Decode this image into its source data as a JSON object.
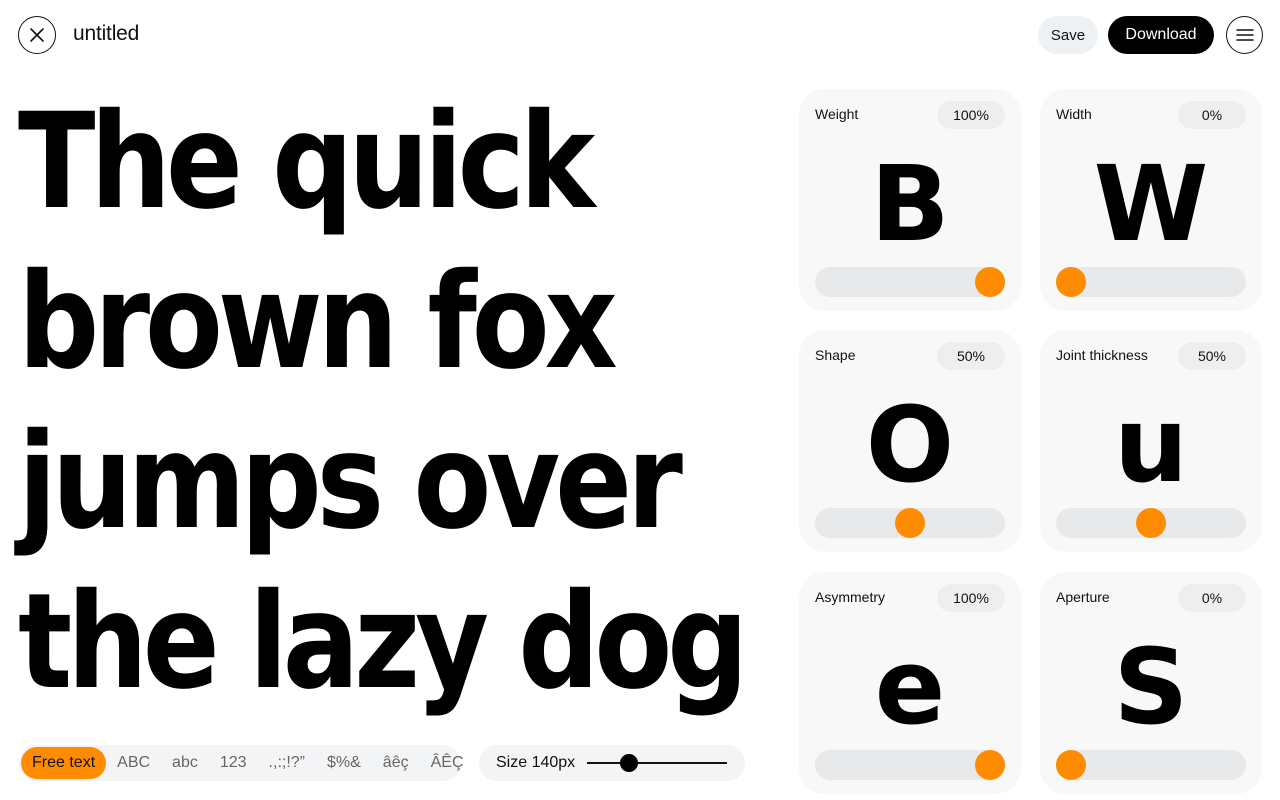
{
  "header": {
    "title": "untitled",
    "save_label": "Save",
    "download_label": "Download"
  },
  "preview": {
    "lines": [
      "The quick",
      "brown fox",
      "jumps over",
      "the lazy dog"
    ]
  },
  "charset_tabs": [
    {
      "label": "Free text",
      "active": true
    },
    {
      "label": "ABC",
      "active": false
    },
    {
      "label": "abc",
      "active": false
    },
    {
      "label": "123",
      "active": false
    },
    {
      "label": ".,:;!?”",
      "active": false
    },
    {
      "label": "$%&",
      "active": false
    },
    {
      "label": "âêç",
      "active": false
    },
    {
      "label": "ÂÊÇ",
      "active": false
    }
  ],
  "size": {
    "label": "Size 140px",
    "level": 0.3
  },
  "axes": [
    {
      "label": "Weight",
      "value_text": "100%",
      "glyph": "B",
      "level": 1.0
    },
    {
      "label": "Width",
      "value_text": "0%",
      "glyph": "W",
      "level": 0.0
    },
    {
      "label": "Shape",
      "value_text": "50%",
      "glyph": "O",
      "level": 0.5
    },
    {
      "label": "Joint thickness",
      "value_text": "50%",
      "glyph": "u",
      "level": 0.5
    },
    {
      "label": "Asymmetry",
      "value_text": "100%",
      "glyph": "e",
      "level": 1.0
    },
    {
      "label": "Aperture",
      "value_text": "0%",
      "glyph": "S",
      "level": 0.0
    }
  ],
  "colors": {
    "accent": "#ff8c00",
    "primary_button": "#000000",
    "card_background": "#f8f8f8"
  }
}
